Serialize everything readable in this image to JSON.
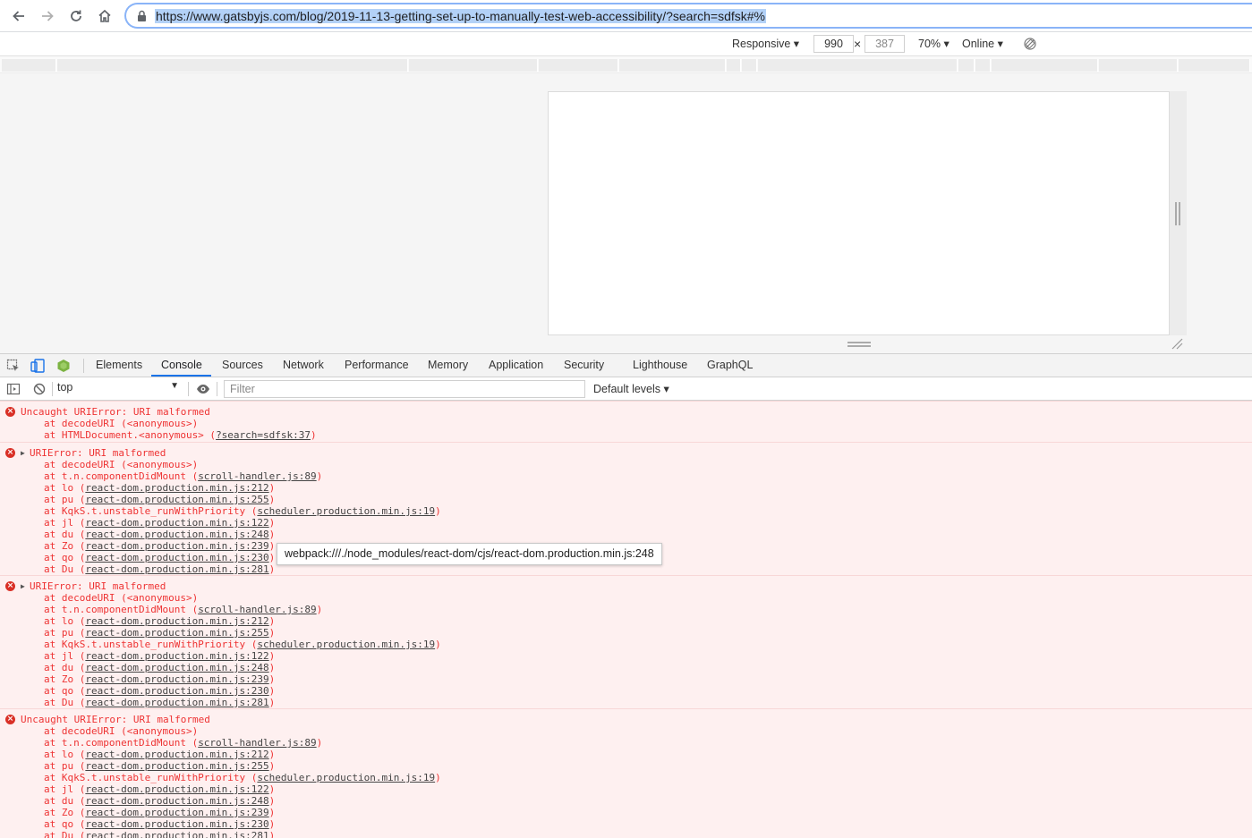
{
  "browser": {
    "url": "https://www.gatsbyjs.com/blog/2019-11-13-getting-set-up-to-manually-test-web-accessibility/?search=sdfsk#%"
  },
  "device_toolbar": {
    "device": "Responsive ▾",
    "width": "990",
    "times": "×",
    "height": "387",
    "zoom": "70% ▾",
    "throttle": "Online ▾"
  },
  "devtools": {
    "tabs": [
      "Elements",
      "Console",
      "Sources",
      "Network",
      "Performance",
      "Memory",
      "Application",
      "Security",
      "Lighthouse",
      "GraphQL"
    ],
    "active_tab": "Console"
  },
  "console_toolbar": {
    "context": "top",
    "filter_placeholder": "Filter",
    "levels": "Default levels ▾"
  },
  "messages": [
    {
      "header": "Uncaught URIError: URI malformed",
      "expandable": false,
      "stack": [
        {
          "text": "at decodeURI (<anonymous>)",
          "link": ""
        },
        {
          "text": "at HTMLDocument.<anonymous> (",
          "link": "?search=sdfsk:37",
          "suffix": ")"
        }
      ]
    },
    {
      "header": "URIError: URI malformed",
      "expandable": true,
      "stack": [
        {
          "text": "at decodeURI (<anonymous>)",
          "link": ""
        },
        {
          "text": "at t.n.componentDidMount (",
          "link": "scroll-handler.js:89",
          "suffix": ")"
        },
        {
          "text": "at lo (",
          "link": "react-dom.production.min.js:212",
          "suffix": ")"
        },
        {
          "text": "at pu (",
          "link": "react-dom.production.min.js:255",
          "suffix": ")"
        },
        {
          "text": "at KqkS.t.unstable_runWithPriority (",
          "link": "scheduler.production.min.js:19",
          "suffix": ")"
        },
        {
          "text": "at jl (",
          "link": "react-dom.production.min.js:122",
          "suffix": ")"
        },
        {
          "text": "at du (",
          "link": "react-dom.production.min.js:248",
          "suffix": ")"
        },
        {
          "text": "at Zo (",
          "link": "react-dom.production.min.js:239",
          "suffix": ")"
        },
        {
          "text": "at qo (",
          "link": "react-dom.production.min.js:230",
          "suffix": ")"
        },
        {
          "text": "at Du (",
          "link": "react-dom.production.min.js:281",
          "suffix": ")"
        }
      ]
    },
    {
      "header": "URIError: URI malformed",
      "expandable": true,
      "stack": [
        {
          "text": "at decodeURI (<anonymous>)",
          "link": ""
        },
        {
          "text": "at t.n.componentDidMount (",
          "link": "scroll-handler.js:89",
          "suffix": ")"
        },
        {
          "text": "at lo (",
          "link": "react-dom.production.min.js:212",
          "suffix": ")"
        },
        {
          "text": "at pu (",
          "link": "react-dom.production.min.js:255",
          "suffix": ")"
        },
        {
          "text": "at KqkS.t.unstable_runWithPriority (",
          "link": "scheduler.production.min.js:19",
          "suffix": ")"
        },
        {
          "text": "at jl (",
          "link": "react-dom.production.min.js:122",
          "suffix": ")"
        },
        {
          "text": "at du (",
          "link": "react-dom.production.min.js:248",
          "suffix": ")"
        },
        {
          "text": "at Zo (",
          "link": "react-dom.production.min.js:239",
          "suffix": ")"
        },
        {
          "text": "at qo (",
          "link": "react-dom.production.min.js:230",
          "suffix": ")"
        },
        {
          "text": "at Du (",
          "link": "react-dom.production.min.js:281",
          "suffix": ")"
        }
      ]
    },
    {
      "header": "Uncaught URIError: URI malformed",
      "expandable": false,
      "stack": [
        {
          "text": "at decodeURI (<anonymous>)",
          "link": ""
        },
        {
          "text": "at t.n.componentDidMount (",
          "link": "scroll-handler.js:89",
          "suffix": ")"
        },
        {
          "text": "at lo (",
          "link": "react-dom.production.min.js:212",
          "suffix": ")"
        },
        {
          "text": "at pu (",
          "link": "react-dom.production.min.js:255",
          "suffix": ")"
        },
        {
          "text": "at KqkS.t.unstable_runWithPriority (",
          "link": "scheduler.production.min.js:19",
          "suffix": ")"
        },
        {
          "text": "at jl (",
          "link": "react-dom.production.min.js:122",
          "suffix": ")"
        },
        {
          "text": "at du (",
          "link": "react-dom.production.min.js:248",
          "suffix": ")"
        },
        {
          "text": "at Zo (",
          "link": "react-dom.production.min.js:239",
          "suffix": ")"
        },
        {
          "text": "at qo (",
          "link": "react-dom.production.min.js:230",
          "suffix": ")"
        },
        {
          "text": "at Du (",
          "link": "react-dom.production.min.js:281",
          "suffix": ")"
        }
      ]
    }
  ],
  "tooltip": "webpack:///./node_modules/react-dom/cjs/react-dom.production.min.js:248",
  "colors": {
    "error_text": "#ee3333",
    "error_bg": "#fef0f0",
    "accent": "#1a73e8"
  }
}
